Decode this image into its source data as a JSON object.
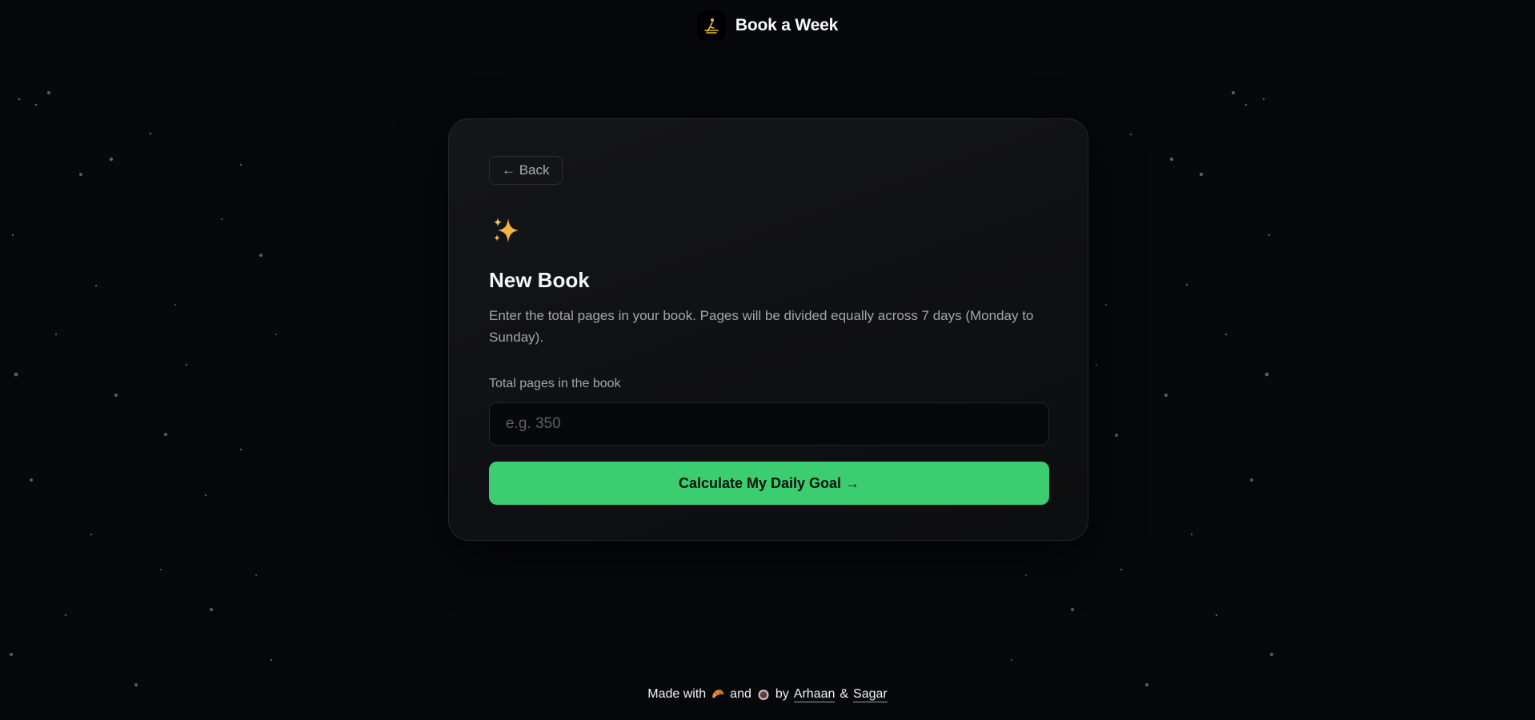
{
  "header": {
    "brand": "Book a Week",
    "logo_icon": "reading-person-icon",
    "logo_color": "#e6c229"
  },
  "card": {
    "back_label": "← Back",
    "sparkle_icon": "sparkles-icon",
    "title": "New Book",
    "description": "Enter the total pages in your book. Pages will be divided equally across 7 days (Monday to Sunday).",
    "field_label": "Total pages in the book",
    "field_placeholder": "e.g. 350",
    "field_value": "",
    "cta_label": "Calculate My Daily Goal →",
    "cta_color": "#3dcd71"
  },
  "footer": {
    "prefix": "Made with",
    "icon_1": "croissant-icon",
    "and": "and",
    "icon_2": "coffee-icon",
    "by": "by",
    "author_1": "Arhaan",
    "amp": "&",
    "author_2": "Sagar"
  },
  "colors": {
    "background": "#07080a",
    "card": "#121316",
    "accent": "#3dcd71"
  }
}
